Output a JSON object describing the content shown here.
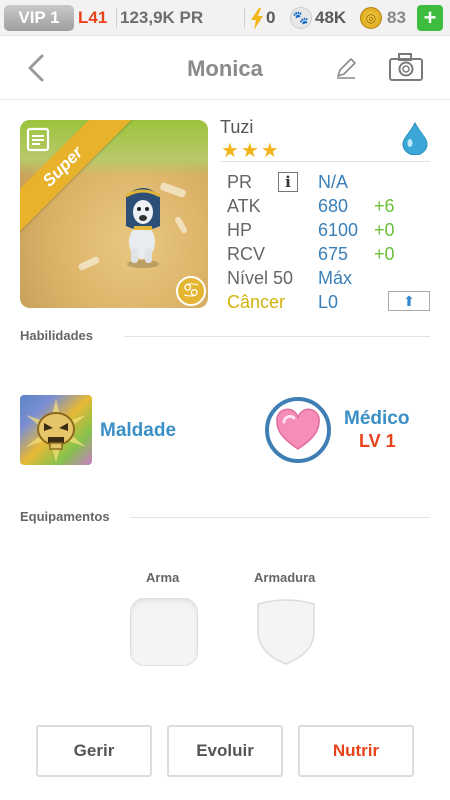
{
  "status_bar": {
    "vip": "VIP 1",
    "level": "L41",
    "pr": "123,9K PR",
    "energy": "0",
    "paws": "48K",
    "coins": "83",
    "plus": "+"
  },
  "header": {
    "title": "Monica"
  },
  "pet": {
    "name": "Tuzi",
    "badge": "Super",
    "stars": "★★★",
    "element": "water-drop"
  },
  "stats": {
    "pr_label": "PR",
    "pr_info": "i",
    "pr_value": "N/A",
    "atk_label": "ATK",
    "atk_value": "680",
    "atk_bonus": "+6",
    "hp_label": "HP",
    "hp_value": "6100",
    "hp_bonus": "+0",
    "rcv_label": "RCV",
    "rcv_value": "675",
    "rcv_bonus": "+0",
    "level_label": "Nível 50",
    "level_value": "Máx",
    "sign_label": "Câncer",
    "sign_value": "L0",
    "zodiac_glyph": "♋",
    "upgrade_glyph": "⬆"
  },
  "skills": {
    "section_title": "Habilidades",
    "skill1_name": "Maldade",
    "skill2_name": "Médico",
    "skill2_level": "LV 1"
  },
  "equipment": {
    "section_title": "Equipamentos",
    "weapon_label": "Arma",
    "armor_label": "Armadura"
  },
  "buttons": {
    "manage": "Gerir",
    "evolve": "Evoluir",
    "feed": "Nutrir"
  },
  "colors": {
    "accent": "#e8431b",
    "stat_value": "#3a7fb8",
    "bonus": "#6dbf3d",
    "zodiac": "#d3b20b",
    "star": "#f2b41b"
  }
}
